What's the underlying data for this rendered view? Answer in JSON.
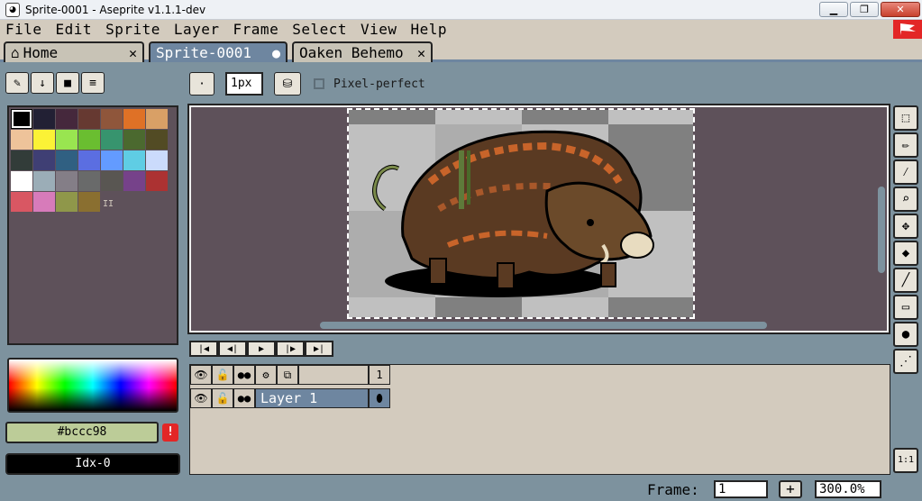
{
  "window": {
    "title": "Sprite-0001 - Aseprite v1.1.1-dev",
    "minimize": "▁",
    "maximize": "❐",
    "close": "✕"
  },
  "menu": [
    "File",
    "Edit",
    "Sprite",
    "Layer",
    "Frame",
    "Select",
    "View",
    "Help"
  ],
  "tabs": [
    {
      "label": "Home",
      "active": false,
      "icon": "home-icon"
    },
    {
      "label": "Sprite-0001",
      "active": true
    },
    {
      "label": "Oaken Behemo",
      "active": false
    }
  ],
  "toolbar": {
    "brush_size": "1px",
    "pixel_perfect_label": "Pixel-perfect",
    "dot_label": "·"
  },
  "palette": {
    "colors": [
      "#000000",
      "#222034",
      "#45283c",
      "#663931",
      "#8f563b",
      "#df7126",
      "#d9a066",
      "#eec39a",
      "#fbf236",
      "#99e550",
      "#6abe30",
      "#37946e",
      "#4b692f",
      "#524b24",
      "#323c39",
      "#3f3f74",
      "#306082",
      "#5b6ee1",
      "#639bff",
      "#5fcde4",
      "#cbdbfc",
      "#ffffff",
      "#9badb7",
      "#847e87",
      "#696a6a",
      "#595652",
      "#76428a",
      "#ac3232",
      "#d95763",
      "#d77bba",
      "#8f974a",
      "#8a6f30"
    ],
    "marker": "II"
  },
  "color": {
    "hex": "#bccc98",
    "index": "Idx-0",
    "warning": "!"
  },
  "timeline": {
    "frame_number": "1",
    "layer_name": "Layer 1"
  },
  "status": {
    "frame_label": "Frame:",
    "frame_value": "1",
    "plus": "+",
    "zoom": "300.0%",
    "one_to_one": "1:1"
  }
}
